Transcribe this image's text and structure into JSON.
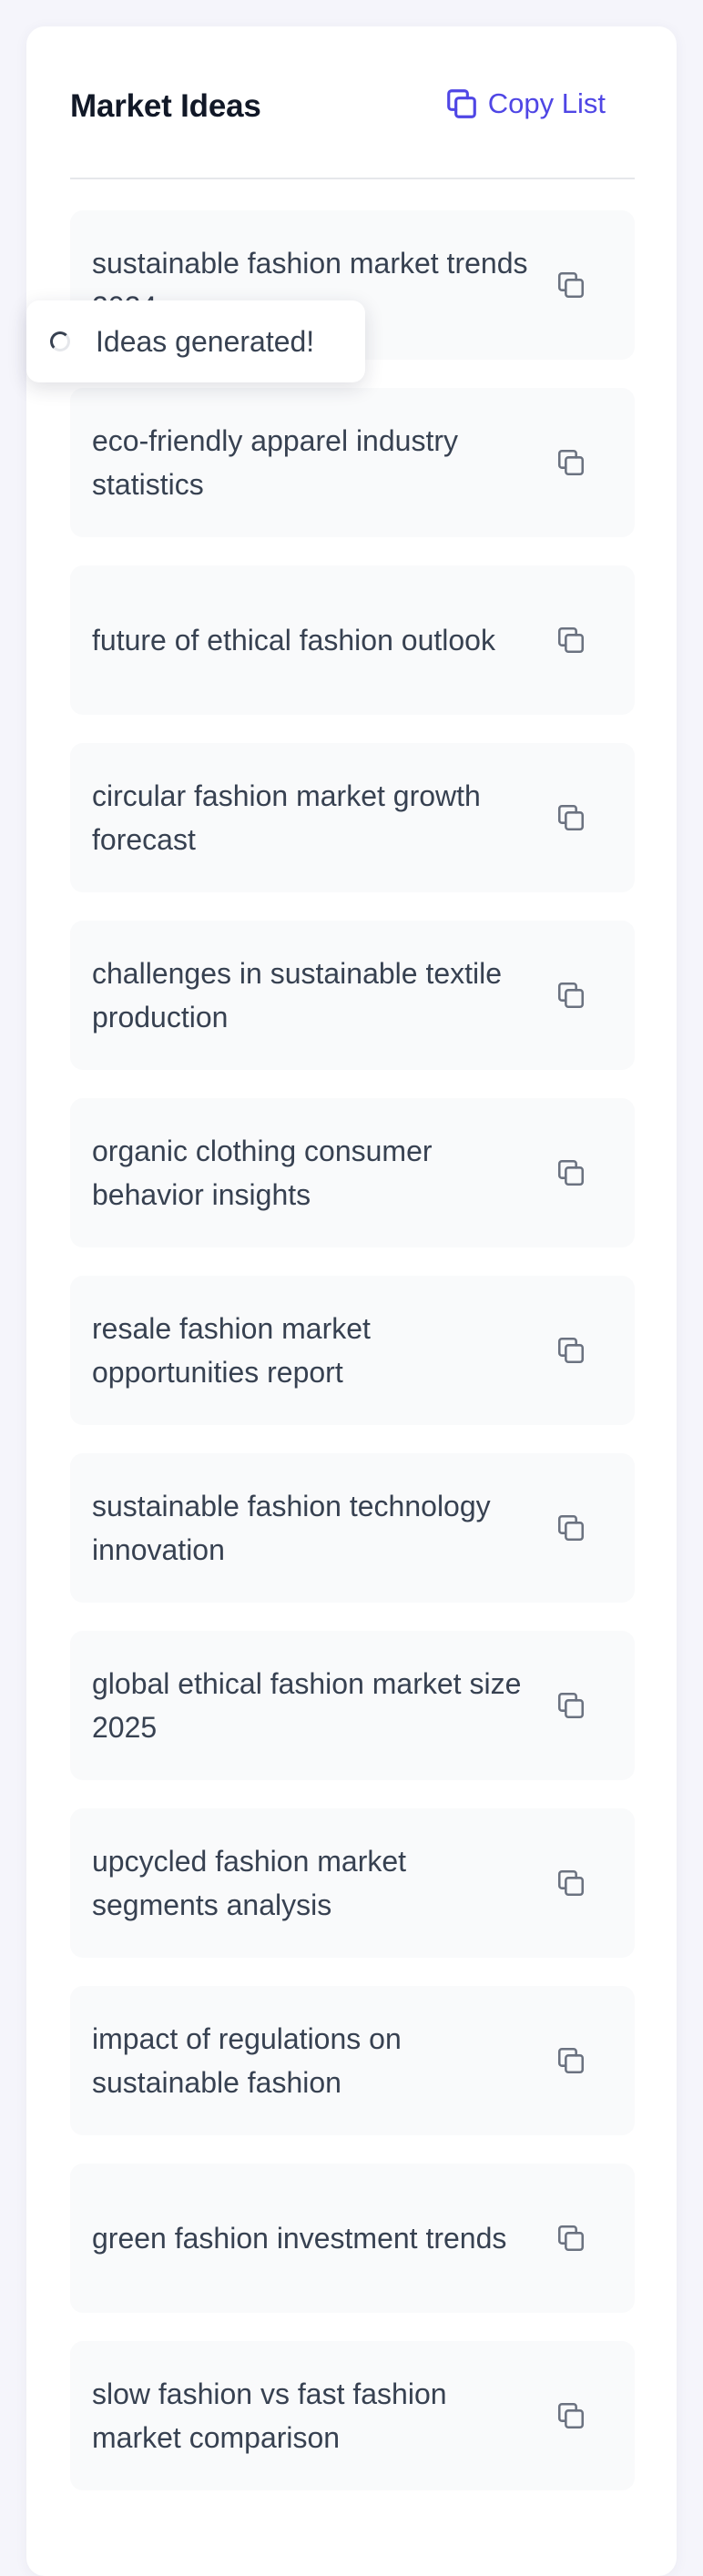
{
  "header": {
    "title": "Market Ideas",
    "copy_list_label": "Copy List",
    "copy_icon": "copy-icon"
  },
  "toast": {
    "message": "Ideas generated!",
    "icon": "spinner-icon"
  },
  "ideas": [
    "sustainable fashion market trends 2024",
    "eco-friendly apparel industry statistics",
    "future of ethical fashion outlook",
    "circular fashion market growth forecast",
    "challenges in sustainable textile production",
    "organic clothing consumer behavior insights",
    "resale fashion market opportunities report",
    "sustainable fashion technology innovation",
    "global ethical fashion market size 2025",
    "upcycled fashion market segments analysis",
    "impact of regulations on sustainable fashion",
    "green fashion investment trends",
    "slow fashion vs fast fashion market comparison"
  ],
  "colors": {
    "accent": "#4f46e5",
    "text": "#374151",
    "item_bg": "#f9fafb",
    "page_bg": "#f5f5fb"
  }
}
